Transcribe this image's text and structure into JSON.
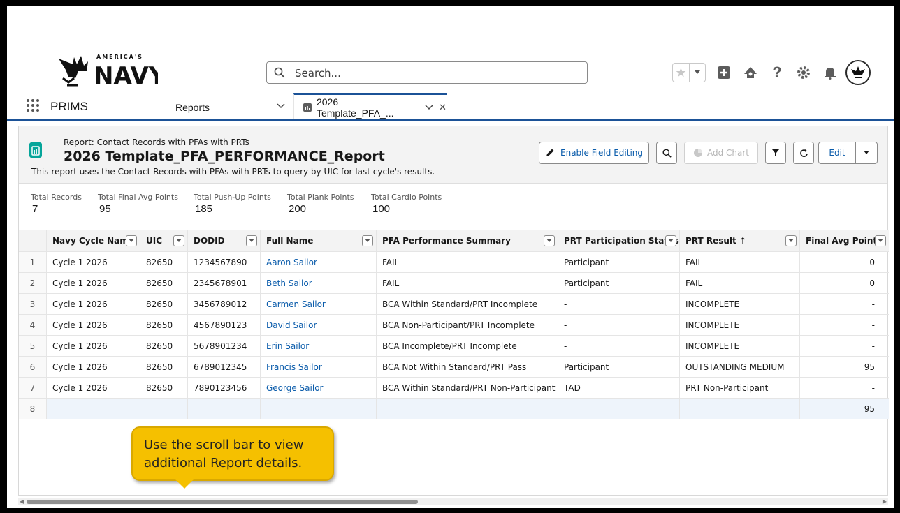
{
  "header": {
    "logo_text": "AMERICA'S NAVY",
    "search_placeholder": "Search...",
    "icons": [
      "star-icon",
      "add-icon",
      "trailhead-icon",
      "help-icon",
      "gear-icon",
      "bell-icon"
    ]
  },
  "nav": {
    "app_name": "PRIMS",
    "reports_label": "Reports",
    "tab_label": "2026 Template_PFA_..."
  },
  "report": {
    "kicker": "Report: Contact Records with PFAs with PRTs",
    "title": "2026 Template_PFA_PERFORMANCE_Report",
    "description": "This report uses the Contact Records with PFAs with PRTs to query by UIC for last cycle's results.",
    "buttons": {
      "enable_field_editing": "Enable Field Editing",
      "add_chart": "Add Chart",
      "edit": "Edit"
    }
  },
  "summary": [
    {
      "label": "Total Records",
      "value": "7"
    },
    {
      "label": "Total Final Avg Points",
      "value": "95"
    },
    {
      "label": "Total Push-Up Points",
      "value": "185"
    },
    {
      "label": "Total Plank Points",
      "value": "200"
    },
    {
      "label": "Total Cardio Points",
      "value": "100"
    }
  ],
  "table": {
    "columns": [
      "Navy Cycle Name",
      "UIC",
      "DODID",
      "Full Name",
      "PFA Performance Summary",
      "PRT Participation Status",
      "PRT Result ↑",
      "Final Avg Points"
    ],
    "rows": [
      {
        "n": "1",
        "cycle": "Cycle 1 2026",
        "uic": "82650",
        "dodid": "1234567890",
        "name": "Aaron Sailor",
        "pfa": "FAIL",
        "status": "Participant",
        "result": "FAIL",
        "points": "0"
      },
      {
        "n": "2",
        "cycle": "Cycle 1 2026",
        "uic": "82650",
        "dodid": "2345678901",
        "name": "Beth Sailor",
        "pfa": "FAIL",
        "status": "Participant",
        "result": "FAIL",
        "points": "0"
      },
      {
        "n": "3",
        "cycle": "Cycle 1 2026",
        "uic": "82650",
        "dodid": "3456789012",
        "name": "Carmen Sailor",
        "pfa": "BCA Within Standard/PRT Incomplete",
        "status": "-",
        "result": "INCOMPLETE",
        "points": "-"
      },
      {
        "n": "4",
        "cycle": "Cycle 1 2026",
        "uic": "82650",
        "dodid": "4567890123",
        "name": "David Sailor",
        "pfa": "BCA Non-Participant/PRT Incomplete",
        "status": "-",
        "result": "INCOMPLETE",
        "points": "-"
      },
      {
        "n": "5",
        "cycle": "Cycle 1 2026",
        "uic": "82650",
        "dodid": "5678901234",
        "name": "Erin Sailor",
        "pfa": "BCA Incomplete/PRT Incomplete",
        "status": "-",
        "result": "INCOMPLETE",
        "points": "-"
      },
      {
        "n": "6",
        "cycle": "Cycle 1 2026",
        "uic": "82650",
        "dodid": "6789012345",
        "name": "Francis Sailor",
        "pfa": "BCA Not Within Standard/PRT Pass",
        "status": "Participant",
        "result": "OUTSTANDING MEDIUM",
        "points": "95"
      },
      {
        "n": "7",
        "cycle": "Cycle 1 2026",
        "uic": "82650",
        "dodid": "7890123456",
        "name": "George Sailor",
        "pfa": "BCA Within Standard/PRT Non-Participant",
        "status": "TAD",
        "result": "PRT Non-Participant",
        "points": "-"
      }
    ],
    "total_row": {
      "n": "8",
      "points": "95"
    }
  },
  "callout": {
    "line1": "Use the scroll bar to view",
    "line2": "additional Report details."
  },
  "colors": {
    "brand_blue": "#1b5297",
    "link_blue": "#0b5cab",
    "callout_yellow": "#f5c000",
    "report_icon_teal": "#06a59a"
  }
}
